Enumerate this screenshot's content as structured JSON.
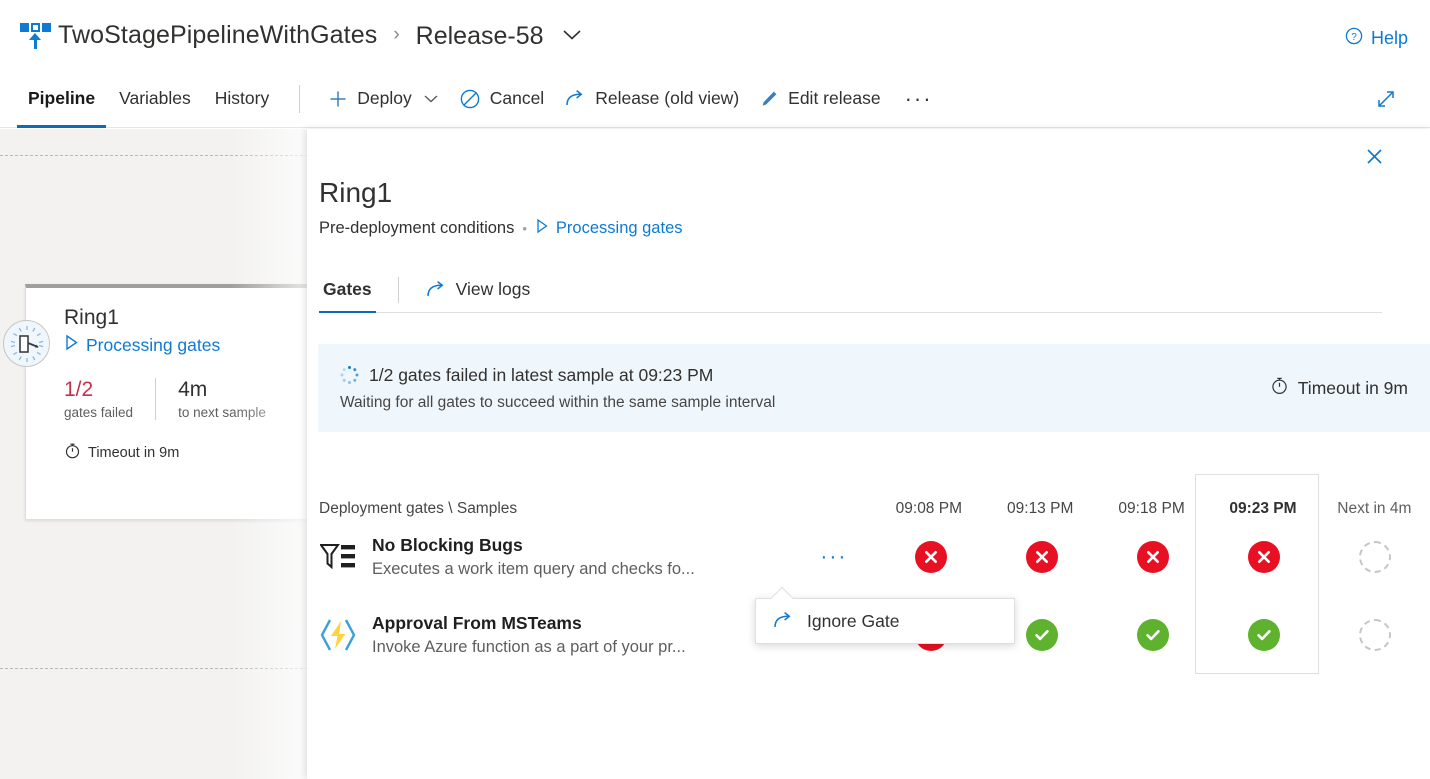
{
  "header": {
    "logo_icon": "release-pipeline-icon",
    "pipeline_name": "TwoStagePipelineWithGates",
    "separator": "›",
    "release_name": "Release-58",
    "release_caret_icon": "chevron-down-icon",
    "help_label": "Help",
    "help_icon": "help-circle-icon"
  },
  "command_bar": {
    "tabs": [
      {
        "label": "Pipeline",
        "active": true
      },
      {
        "label": "Variables",
        "active": false
      },
      {
        "label": "History",
        "active": false
      }
    ],
    "buttons": [
      {
        "label": "Deploy",
        "icon": "plus-icon",
        "caret": true
      },
      {
        "label": "Cancel",
        "icon": "cancel-circle-icon",
        "caret": false
      },
      {
        "label": "Release (old view)",
        "icon": "navigate-external-icon",
        "caret": false
      },
      {
        "label": "Edit release",
        "icon": "pencil-icon",
        "caret": false
      }
    ],
    "overflow_label": "···",
    "expand_icon": "full-screen-icon"
  },
  "stage_card": {
    "status_icon": "gates-clock-icon",
    "title": "Ring1",
    "status_icon_inline": "play-triangle-icon",
    "status_text": "Processing gates",
    "stats": [
      {
        "value": "1/2",
        "label": "gates failed",
        "state": "fail"
      },
      {
        "value": "4m",
        "label": "to next sample",
        "state": "neutral"
      }
    ],
    "timeout_icon": "timer-icon",
    "timeout_text": "Timeout in 9m"
  },
  "panel": {
    "close_icon": "close-icon",
    "title": "Ring1",
    "subtitle": "Pre-deployment conditions",
    "subtitle_separator": "•",
    "status_icon": "play-triangle-icon",
    "status_text": "Processing gates",
    "tabs": [
      {
        "label": "Gates",
        "active": true,
        "icon": null
      },
      {
        "label": "View logs",
        "active": false,
        "icon": "navigate-external-icon"
      }
    ]
  },
  "banner": {
    "spinner_icon": "loading-spinner-icon",
    "headline": "1/2 gates failed in latest sample at 09:23 PM",
    "subline": "Waiting for all gates to succeed within the same sample interval",
    "timeout_icon": "timer-icon",
    "timeout_text": "Timeout in 9m",
    "background_color": "#eff6fc"
  },
  "gates_table": {
    "name_column_header": "Deployment gates \\ Samples",
    "sample_columns": [
      {
        "label": "09:08 PM",
        "current": false,
        "next": false
      },
      {
        "label": "09:13 PM",
        "current": false,
        "next": false
      },
      {
        "label": "09:18 PM",
        "current": false,
        "next": false
      },
      {
        "label": "09:23 PM",
        "current": true,
        "next": false
      },
      {
        "label": "Next in 4m",
        "current": false,
        "next": true
      }
    ],
    "rows": [
      {
        "icon": "work-item-query-icon",
        "name": "No Blocking Bugs",
        "description": "Executes a work item query and checks fo...",
        "more_label": "···",
        "results": [
          "fail",
          "fail",
          "fail",
          "fail",
          "pending"
        ]
      },
      {
        "icon": "azure-function-icon",
        "name": "Approval From MSTeams",
        "description": "Invoke Azure function as a part of your pr...",
        "more_label": "···",
        "results": [
          "fail",
          "pass",
          "pass",
          "pass",
          "pending"
        ]
      }
    ]
  },
  "callout": {
    "icon": "navigate-external-icon",
    "label": "Ignore Gate"
  },
  "colors": {
    "accent_blue": "#0e7ad4",
    "tab_underline": "#0b6cb8",
    "fail_red": "#e81123",
    "pass_green": "#5eb22e",
    "fail_text_red": "#c4314b",
    "canvas_gray": "#f3f2f1",
    "banner_blue": "#eff6fc"
  }
}
